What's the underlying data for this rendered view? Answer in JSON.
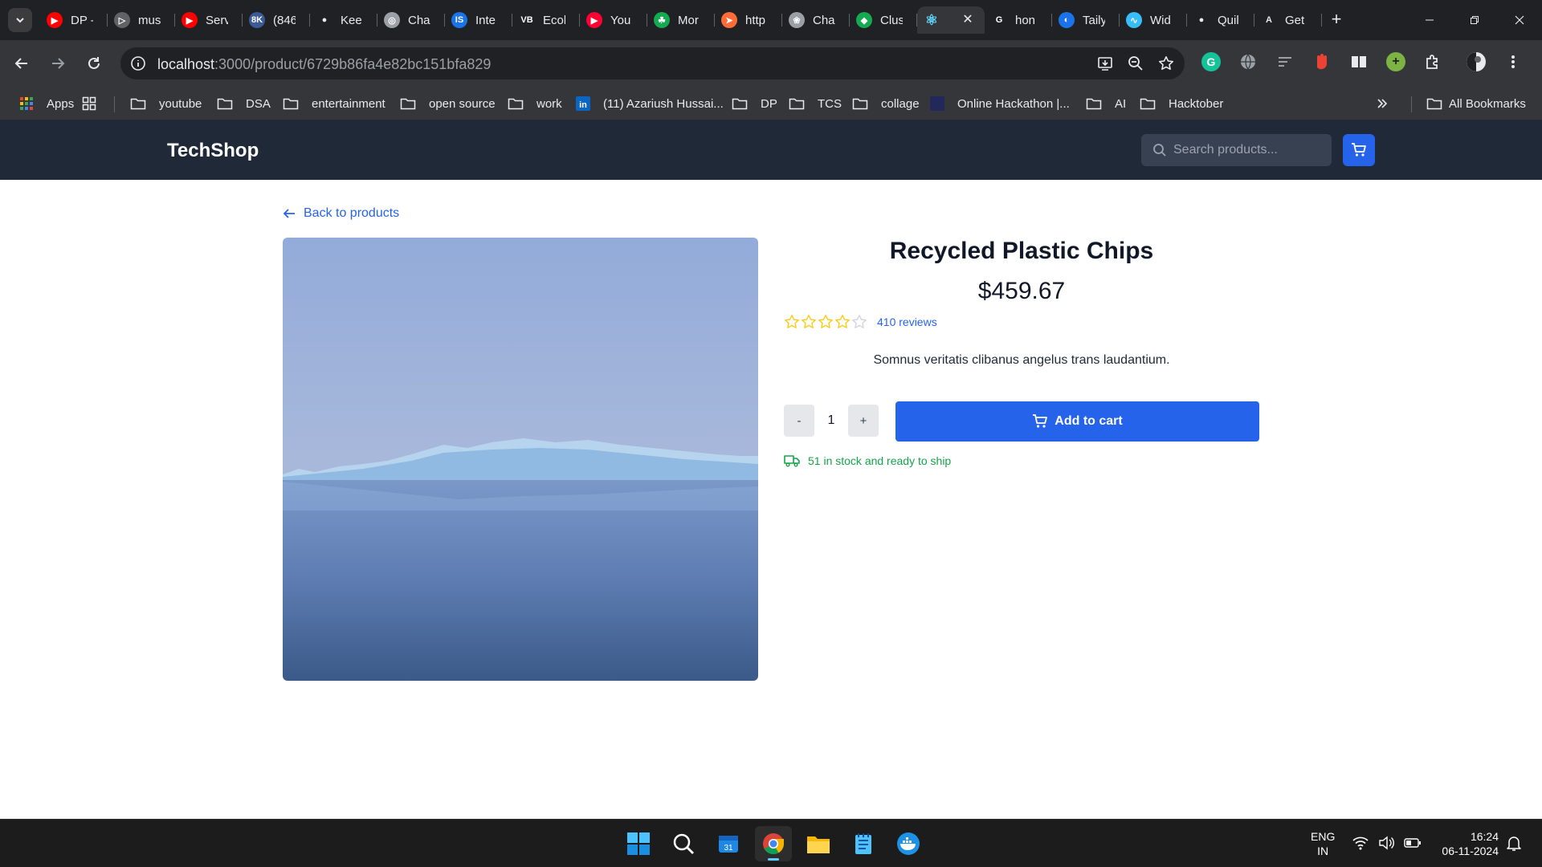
{
  "browser": {
    "tabs": [
      {
        "title": "DP -",
        "icon": "youtube-icon",
        "color": "#ff0000"
      },
      {
        "title": "mus",
        "icon": "play-icon",
        "color": "#5f6368"
      },
      {
        "title": "Serv",
        "icon": "youtube-icon",
        "color": "#ff0000"
      },
      {
        "title": "(846",
        "icon": "8k-icon",
        "color": "#3d5a98"
      },
      {
        "title": "Kee",
        "icon": "github-icon",
        "color": "#e8eaed"
      },
      {
        "title": "Cha",
        "icon": "globe-icon",
        "color": "#9aa0a6"
      },
      {
        "title": "Inte",
        "icon": "is-icon",
        "color": "#1a73e8"
      },
      {
        "title": "Ecol",
        "icon": "vb-icon",
        "color": "#ffffff"
      },
      {
        "title": "You",
        "icon": "youtube-circle-icon",
        "color": "#ff0033"
      },
      {
        "title": "Mor",
        "icon": "leaf-icon",
        "color": "#13aa52"
      },
      {
        "title": "http",
        "icon": "postman-icon",
        "color": "#ff6c37"
      },
      {
        "title": "Cha",
        "icon": "openai-icon",
        "color": "#9aa0a6"
      },
      {
        "title": "Clus",
        "icon": "mongodb-icon",
        "color": "#13aa52"
      },
      {
        "title": "",
        "icon": "react-icon",
        "color": "#61dafb"
      },
      {
        "title": "hon",
        "icon": "google-icon",
        "color": "#ffffff"
      },
      {
        "title": "Taily",
        "icon": "tailwind-blue-icon",
        "color": "#1a73e8"
      },
      {
        "title": "Wid",
        "icon": "tailwind-icon",
        "color": "#38bdf8"
      },
      {
        "title": "Quil",
        "icon": "github-icon",
        "color": "#e8eaed"
      },
      {
        "title": "Get",
        "icon": "a-icon",
        "color": "#e8eaed"
      }
    ],
    "url_host": "localhost",
    "url_path": ":3000/product/6729b86fa4e82bc151bfa829",
    "bookmarks": [
      {
        "label": "Apps",
        "icon": "apps-grid-icon"
      },
      {
        "label": "",
        "icon": "squares-icon"
      },
      {
        "label": "youtube",
        "icon": "folder-icon"
      },
      {
        "label": "DSA",
        "icon": "folder-icon"
      },
      {
        "label": "entertainment",
        "icon": "folder-icon"
      },
      {
        "label": "open source",
        "icon": "folder-icon"
      },
      {
        "label": "work",
        "icon": "folder-icon"
      },
      {
        "label": "(11) Azariush Hussai...",
        "icon": "linkedin-icon"
      },
      {
        "label": "DP",
        "icon": "folder-icon"
      },
      {
        "label": "TCS",
        "icon": "folder-icon"
      },
      {
        "label": "collage",
        "icon": "folder-icon"
      },
      {
        "label": "Online Hackathon |...",
        "icon": "hackathon-icon"
      },
      {
        "label": "AI",
        "icon": "folder-icon"
      },
      {
        "label": "Hacktober",
        "icon": "folder-icon"
      }
    ],
    "all_bookmarks": "All Bookmarks"
  },
  "site": {
    "logo": "TechShop",
    "search_placeholder": "Search products..."
  },
  "product": {
    "back_label": "Back to products",
    "title": "Recycled Plastic Chips",
    "price": "$459.67",
    "rating": 4,
    "rating_max": 5,
    "reviews": "410 reviews",
    "description": "Somnus veritatis clibanus angelus trans laudantium.",
    "qty_minus": "-",
    "qty_value": "1",
    "qty_plus": "+",
    "add_to_cart": "Add to cart",
    "stock": "51 in stock and ready to ship",
    "star_color": "#facc15"
  },
  "taskbar": {
    "apps": [
      "windows-start-icon",
      "search-icon",
      "calendar-icon",
      "chrome-icon",
      "file-explorer-icon",
      "notepad-icon",
      "docker-icon"
    ],
    "lang_line1": "ENG",
    "lang_line2": "IN",
    "time": "16:24",
    "date": "06-11-2024"
  },
  "colors": {
    "accent": "#2563eb",
    "header_bg": "#1f2937",
    "stock_green": "#16a34a"
  }
}
